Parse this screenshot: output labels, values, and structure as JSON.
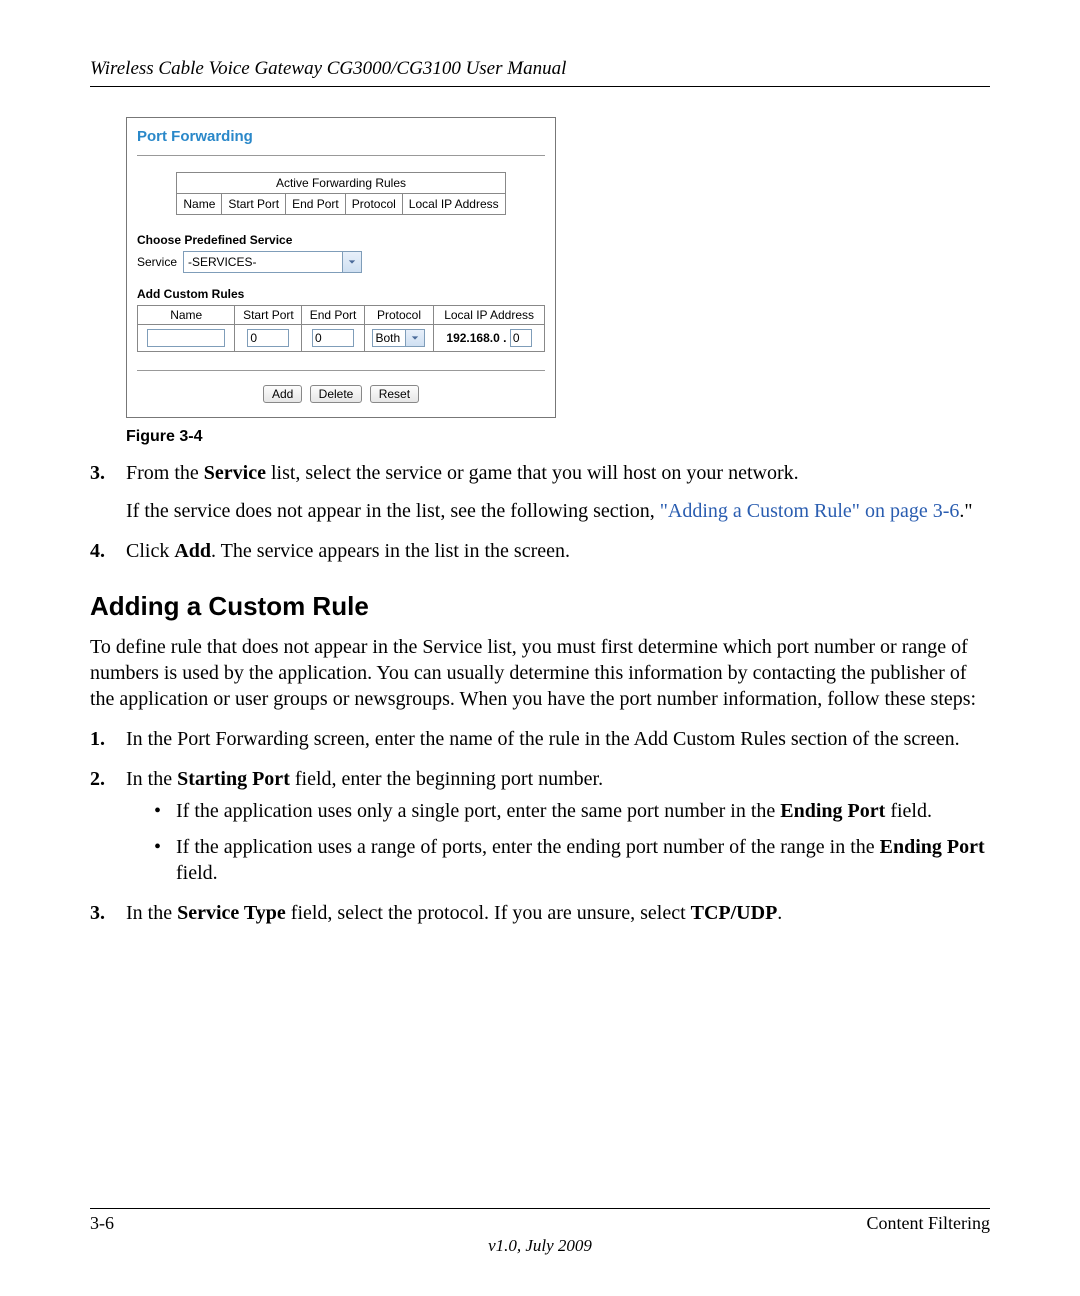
{
  "header": {
    "title": "Wireless Cable Voice Gateway CG3000/CG3100 User Manual"
  },
  "router": {
    "title": "Port Forwarding",
    "active_rules_caption": "Active Forwarding Rules",
    "active_cols": {
      "name": "Name",
      "start": "Start Port",
      "end": "End Port",
      "proto": "Protocol",
      "ip": "Local IP Address"
    },
    "predefined_label": "Choose Predefined Service",
    "service_label": "Service",
    "service_value": "-SERVICES-",
    "custom_label": "Add Custom Rules",
    "custom_cols": {
      "name": "Name",
      "start": "Start Port",
      "end": "End Port",
      "proto": "Protocol",
      "ip": "Local IP Address"
    },
    "custom_row": {
      "name": "",
      "start": "0",
      "end": "0",
      "proto": "Both",
      "ip_prefix": "192.168.0 .",
      "ip_last": "0"
    },
    "buttons": {
      "add": "Add",
      "delete": "Delete",
      "reset": "Reset"
    }
  },
  "figure_caption": "Figure 3-4",
  "steps_top": {
    "s3": {
      "num": "3.",
      "t1": "From the ",
      "b1": "Service",
      "t2": " list, select the service or game that you will host on your network.",
      "p2a": "If the service does not appear in the list, see the following section, ",
      "link": "\"Adding a Custom Rule\" on page 3-6",
      "p2b": ".\""
    },
    "s4": {
      "num": "4.",
      "t1": "Click ",
      "b1": "Add",
      "t2": ". The service appears in the list in the screen."
    }
  },
  "section_heading": "Adding a Custom Rule",
  "section_intro": "To define rule that does not appear in the Service list, you must first determine which port number or range of numbers is used by the application. You can usually determine this information by contacting the publisher of the application or user groups or newsgroups. When you have the port number information, follow these steps:",
  "steps_bottom": {
    "s1": {
      "num": "1.",
      "t": "In the Port Forwarding screen, enter the name of the rule in the Add Custom Rules section of the screen."
    },
    "s2": {
      "num": "2.",
      "t1": "In the ",
      "b1": "Starting Port",
      "t2": " field, enter the beginning port number.",
      "bul1a": "If the application uses only a single port, enter the same port number in the ",
      "bul1b": "Ending Port",
      "bul1c": " field.",
      "bul2a": "If the application uses a range of ports, enter the ending port number of the range in the ",
      "bul2b": "Ending Port",
      "bul2c": " field."
    },
    "s3": {
      "num": "3.",
      "t1": "In the ",
      "b1": "Service Type",
      "t2": " field, select the protocol. If you are unsure, select ",
      "b2": "TCP/UDP",
      "t3": "."
    }
  },
  "footer": {
    "left": "3-6",
    "right": "Content Filtering",
    "version": "v1.0, July 2009"
  }
}
